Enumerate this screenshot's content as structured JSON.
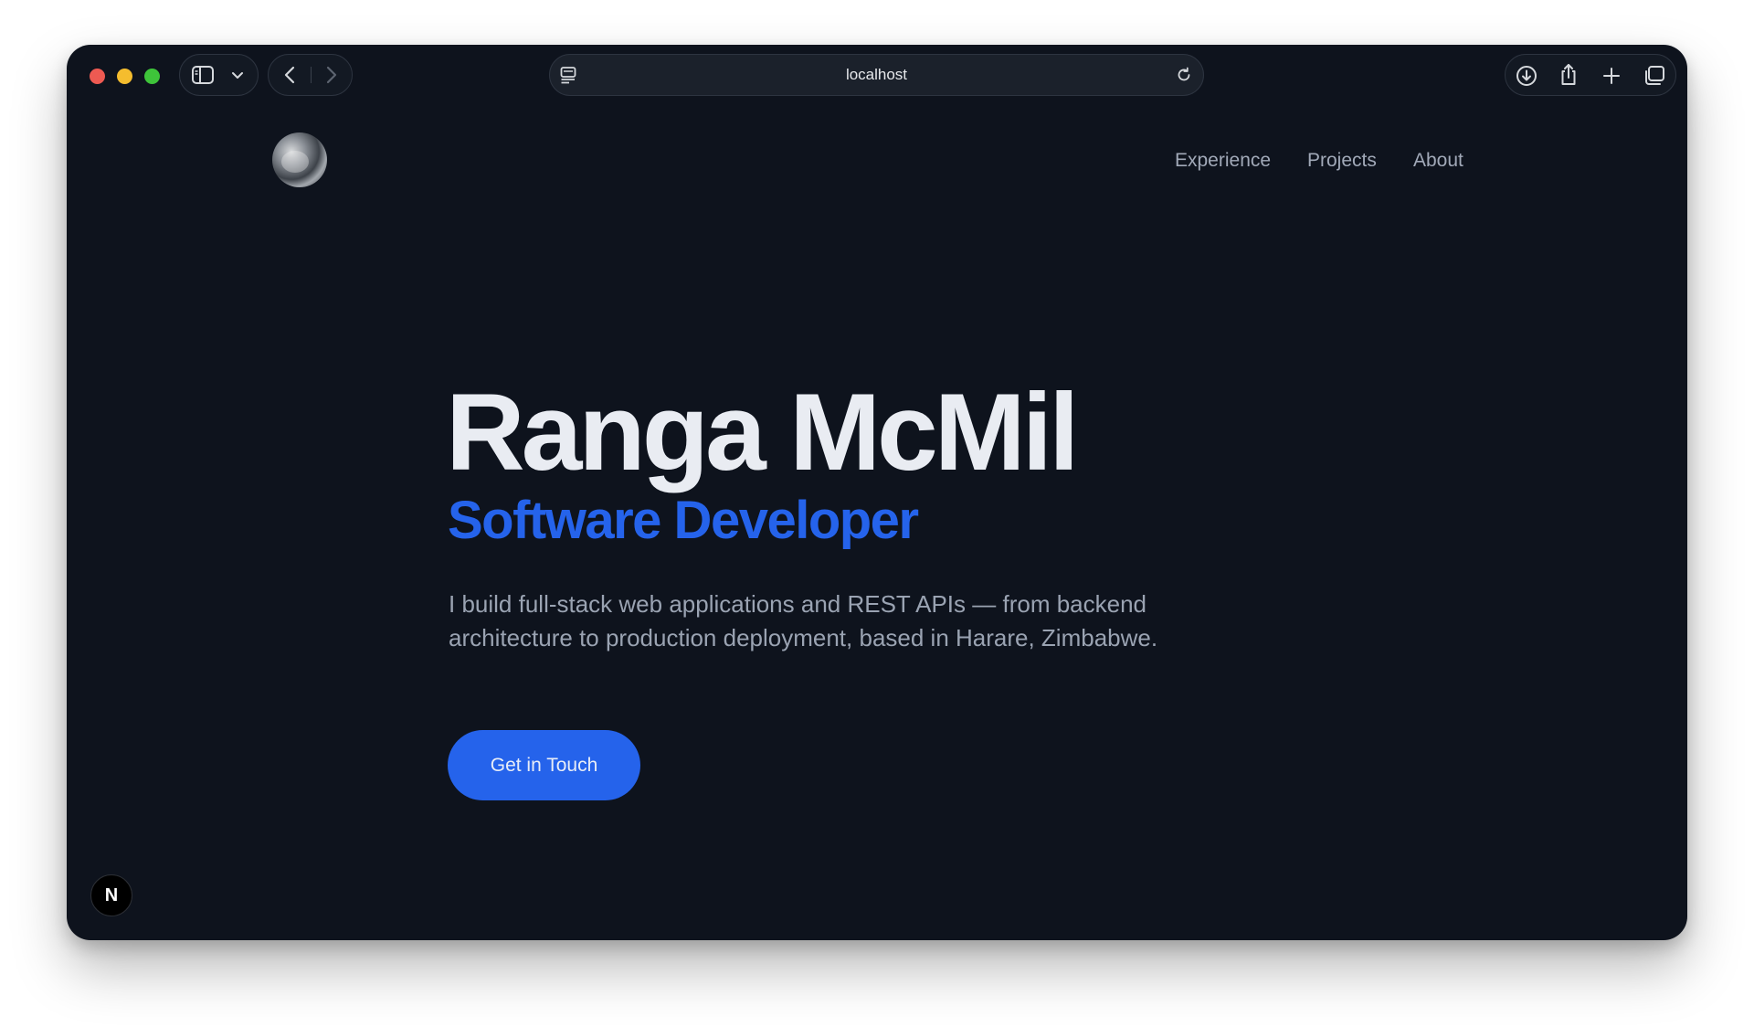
{
  "browser": {
    "address": "localhost",
    "icons": [
      "sidebar-icon",
      "chevron-down-icon",
      "back-icon",
      "forward-icon",
      "page-menu-icon",
      "reload-icon",
      "download-icon",
      "share-icon",
      "new-tab-icon",
      "tabs-overview-icon"
    ]
  },
  "site": {
    "nav": {
      "experience": "Experience",
      "projects": "Projects",
      "about": "About"
    },
    "hero": {
      "name": "Ranga McMil",
      "role": "Software Developer",
      "description": "I build full-stack web applications and REST APIs — from backend architecture to production deployment, based in Harare, Zimbabwe.",
      "cta": "Get in Touch"
    },
    "dev_badge": "N"
  },
  "colors": {
    "background": "#0e131d",
    "accent": "#2563eb",
    "heading": "#e9ecf2",
    "muted": "#9aa3b2"
  }
}
